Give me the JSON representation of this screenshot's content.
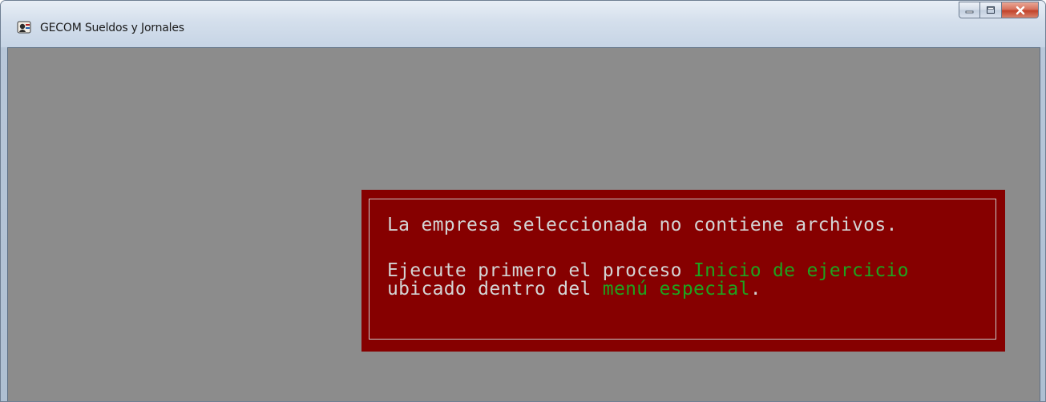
{
  "window": {
    "title": "GECOM Sueldos y Jornales",
    "icon": "app-icon",
    "controls": {
      "minimize": "minimize-icon",
      "maximize": "maximize-icon",
      "close": "close-icon"
    }
  },
  "dialog": {
    "line1": "La empresa seleccionada no contiene archivos.",
    "line2_prefix": "Ejecute primero el proceso ",
    "line2_highlight": "Inicio de ejercicio",
    "line3_prefix": "ubicado dentro del ",
    "line3_highlight": "menú especial",
    "line3_suffix": "."
  },
  "colors": {
    "client_background": "#8c8c8c",
    "dialog_background": "#860000",
    "dialog_text": "#d4d4d4",
    "highlight_text": "#1ea31e"
  }
}
